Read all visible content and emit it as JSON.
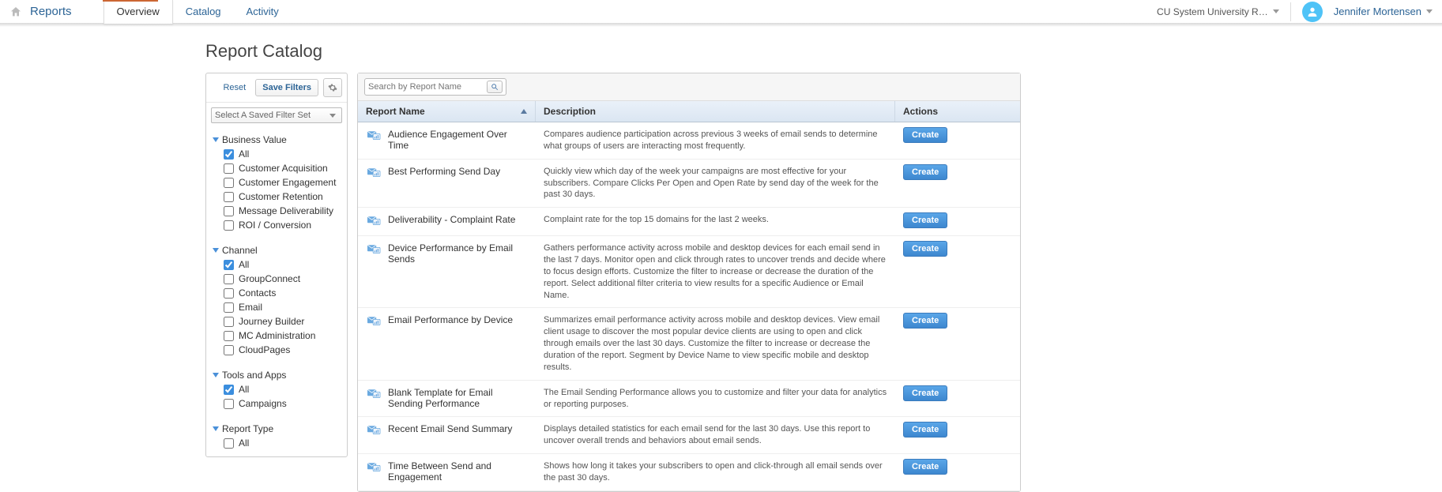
{
  "header": {
    "app": "Reports",
    "tabs": [
      {
        "label": "Overview",
        "active": true
      },
      {
        "label": "Catalog",
        "active": false
      },
      {
        "label": "Activity",
        "active": false
      }
    ],
    "account": "CU System University R…",
    "user": "Jennifer Mortensen"
  },
  "page_title": "Report Catalog",
  "filters": {
    "reset": "Reset",
    "save": "Save Filters",
    "saved_select": "Select A Saved Filter Set",
    "groups": [
      {
        "title": "Business Value",
        "items": [
          {
            "label": "All",
            "checked": true
          },
          {
            "label": "Customer Acquisition",
            "checked": false
          },
          {
            "label": "Customer Engagement",
            "checked": false
          },
          {
            "label": "Customer Retention",
            "checked": false
          },
          {
            "label": "Message Deliverability",
            "checked": false
          },
          {
            "label": "ROI / Conversion",
            "checked": false
          }
        ]
      },
      {
        "title": "Channel",
        "items": [
          {
            "label": "All",
            "checked": true
          },
          {
            "label": "GroupConnect",
            "checked": false
          },
          {
            "label": "Contacts",
            "checked": false
          },
          {
            "label": "Email",
            "checked": false
          },
          {
            "label": "Journey Builder",
            "checked": false
          },
          {
            "label": "MC Administration",
            "checked": false
          },
          {
            "label": "CloudPages",
            "checked": false
          }
        ]
      },
      {
        "title": "Tools and Apps",
        "items": [
          {
            "label": "All",
            "checked": true
          },
          {
            "label": "Campaigns",
            "checked": false
          }
        ]
      },
      {
        "title": "Report Type",
        "items": [
          {
            "label": "All",
            "checked": false
          }
        ]
      }
    ]
  },
  "search": {
    "placeholder": "Search by Report Name"
  },
  "columns": {
    "name": "Report Name",
    "desc": "Description",
    "act": "Actions",
    "create": "Create"
  },
  "reports": [
    {
      "name": "Audience Engagement Over Time",
      "desc": "Compares audience participation across previous 3 weeks of email sends to determine what groups of users are interacting most frequently."
    },
    {
      "name": "Best Performing Send Day",
      "desc": "Quickly view which day of the week your campaigns are most effective for your subscribers. Compare Clicks Per Open and Open Rate by send day of the week for the past 30 days."
    },
    {
      "name": "Deliverability - Complaint Rate",
      "desc": "Complaint rate for the top 15 domains for the last 2 weeks."
    },
    {
      "name": "Device Performance by Email Sends",
      "desc": "Gathers performance activity across mobile and desktop devices for each email send in the last 7 days. Monitor open and click through rates to uncover trends and decide where to focus design efforts. Customize the filter to increase or decrease the duration of the report. Select additional filter criteria to view results for a specific Audience or Email Name."
    },
    {
      "name": "Email Performance by Device",
      "desc": "Summarizes email performance activity across mobile and desktop devices. View email client usage to discover the most popular device clients are using to open and click through emails over the last 30 days. Customize the filter to increase or decrease the duration of the report. Segment by Device Name to view specific mobile and desktop results."
    },
    {
      "name": "Blank Template for Email Sending Performance",
      "desc": "The Email Sending Performance allows you to customize and filter your data for analytics or reporting purposes."
    },
    {
      "name": "Recent Email Send Summary",
      "desc": "Displays detailed statistics for each email send for the last 30 days. Use this report to uncover overall trends and behaviors about email sends."
    },
    {
      "name": "Time Between Send and Engagement",
      "desc": "Shows how long it takes your subscribers to open and click-through all email sends over the past 30 days."
    }
  ]
}
